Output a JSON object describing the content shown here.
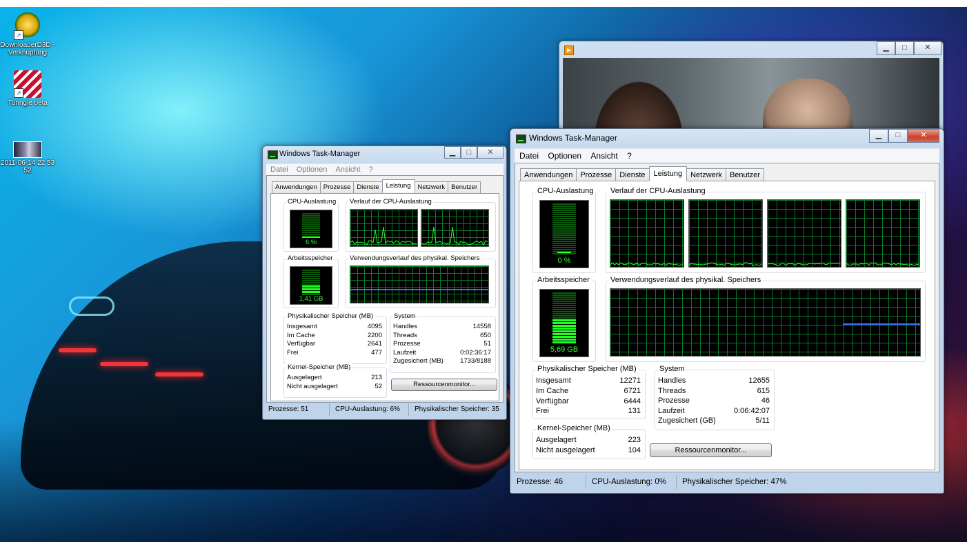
{
  "desktop": {
    "icons": [
      {
        "label": "DownloaderD3D - Verknüpfung",
        "icon": "downloader-icon"
      },
      {
        "label": "Tunngle beta",
        "icon": "tunngle-icon"
      },
      {
        "label": "2011-06-14 22 53 52",
        "icon": "photo-icon"
      }
    ]
  },
  "video_window": {
    "controls": {
      "minimize": "▁",
      "maximize": "□",
      "close": "✕"
    }
  },
  "tm_small": {
    "title": "Windows Task-Manager",
    "menu": [
      "Datei",
      "Optionen",
      "Ansicht",
      "?"
    ],
    "tabs": [
      "Anwendungen",
      "Prozesse",
      "Dienste",
      "Leistung",
      "Netzwerk",
      "Benutzer"
    ],
    "active_tab": "Leistung",
    "cpu": {
      "label": "CPU-Auslastung",
      "value": "6 %",
      "level": 0.06
    },
    "cpu_history_label": "Verlauf der CPU-Auslastung",
    "memory": {
      "label": "Arbeitsspeicher",
      "value": "1,41 GB",
      "level": 0.35
    },
    "memory_history_label": "Verwendungsverlauf des physikal. Speichers",
    "physical": {
      "title": "Physikalischer Speicher (MB)",
      "rows": [
        {
          "k": "Insgesamt",
          "v": "4095"
        },
        {
          "k": "Im Cache",
          "v": "2200"
        },
        {
          "k": "Verfügbar",
          "v": "2641"
        },
        {
          "k": "Frei",
          "v": "477"
        }
      ]
    },
    "system": {
      "title": "System",
      "rows": [
        {
          "k": "Handles",
          "v": "14558"
        },
        {
          "k": "Threads",
          "v": "650"
        },
        {
          "k": "Prozesse",
          "v": "51"
        },
        {
          "k": "Laufzeit",
          "v": "0:02:36:17"
        },
        {
          "k": "Zugesichert (MB)",
          "v": "1733/8188"
        }
      ]
    },
    "kernel": {
      "title": "Kernel-Speicher (MB)",
      "rows": [
        {
          "k": "Ausgelagert",
          "v": "213"
        },
        {
          "k": "Nicht ausgelagert",
          "v": "52"
        }
      ]
    },
    "button": "Ressourcenmonitor...",
    "status": [
      "Prozesse: 51",
      "CPU-Auslastung: 6%",
      "Physikalischer Speicher: 35"
    ]
  },
  "tm_large": {
    "title": "Windows Task-Manager",
    "menu": [
      "Datei",
      "Optionen",
      "Ansicht",
      "?"
    ],
    "tabs": [
      "Anwendungen",
      "Prozesse",
      "Dienste",
      "Leistung",
      "Netzwerk",
      "Benutzer"
    ],
    "active_tab": "Leistung",
    "cpu": {
      "label": "CPU-Auslastung",
      "value": "0 %",
      "level": 0.0
    },
    "cpu_history_label": "Verlauf der CPU-Auslastung",
    "memory": {
      "label": "Arbeitsspeicher",
      "value": "5,69 GB",
      "level": 0.47
    },
    "memory_history_label": "Verwendungsverlauf des physikal. Speichers",
    "physical": {
      "title": "Physikalischer Speicher (MB)",
      "rows": [
        {
          "k": "Insgesamt",
          "v": "12271"
        },
        {
          "k": "Im Cache",
          "v": "6721"
        },
        {
          "k": "Verfügbar",
          "v": "6444"
        },
        {
          "k": "Frei",
          "v": "131"
        }
      ]
    },
    "system": {
      "title": "System",
      "rows": [
        {
          "k": "Handles",
          "v": "12655"
        },
        {
          "k": "Threads",
          "v": "615"
        },
        {
          "k": "Prozesse",
          "v": "46"
        },
        {
          "k": "Laufzeit",
          "v": "0:06:42:07"
        },
        {
          "k": "Zugesichert (GB)",
          "v": "5/11"
        }
      ]
    },
    "kernel": {
      "title": "Kernel-Speicher (MB)",
      "rows": [
        {
          "k": "Ausgelagert",
          "v": "223"
        },
        {
          "k": "Nicht ausgelagert",
          "v": "104"
        }
      ]
    },
    "button": "Ressourcenmonitor...",
    "status": [
      "Prozesse: 46",
      "CPU-Auslastung: 0%",
      "Physikalischer Speicher: 47%"
    ]
  },
  "colors": {
    "graph_grid": "#0a7a2a",
    "cpu_line": "#22ff22",
    "memory_line": "#3a6cff"
  }
}
